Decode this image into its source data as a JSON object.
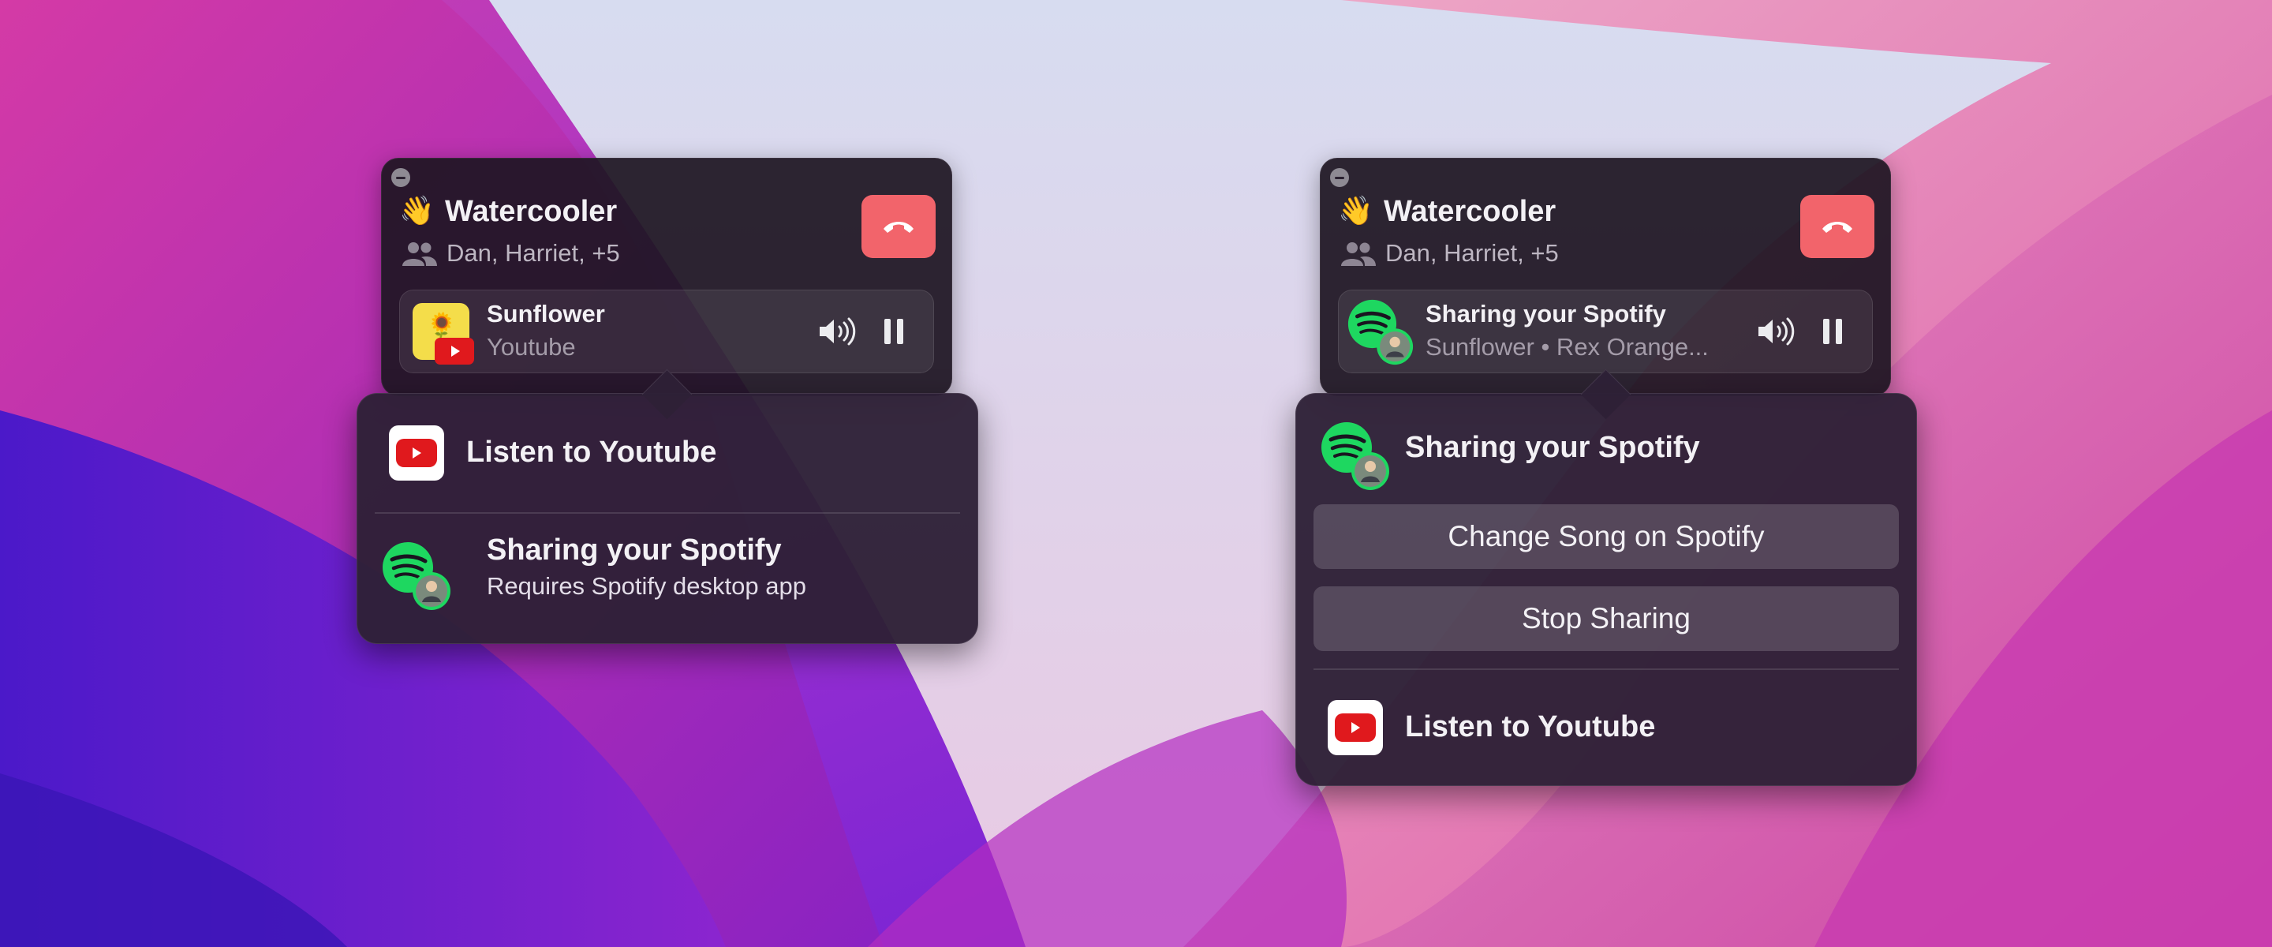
{
  "panels": [
    {
      "room": {
        "emoji": "👋",
        "title": "Watercooler",
        "participants": "Dan, Harriet, +5"
      },
      "media": {
        "title": "Sunflower",
        "subtitle": "Youtube",
        "thumb_emoji": "🌻"
      },
      "menu": {
        "youtube_option": "Listen to Youtube",
        "spotify_title": "Sharing your Spotify",
        "spotify_subtitle": "Requires Spotify desktop app"
      }
    },
    {
      "room": {
        "emoji": "👋",
        "title": "Watercooler",
        "participants": "Dan, Harriet, +5"
      },
      "media": {
        "title": "Sharing your Spotify",
        "subtitle": "Sunflower • Rex Orange..."
      },
      "menu": {
        "spotify_title": "Sharing your Spotify",
        "change_song": "Change Song on Spotify",
        "stop_sharing": "Stop Sharing",
        "youtube_option": "Listen to Youtube"
      }
    }
  ],
  "colors": {
    "hangup": "#f2646b",
    "youtube_red": "#e0191d",
    "spotify_green": "#1ed760",
    "panel_bg": "#1e1622",
    "popover_bg": "#2e2036"
  }
}
